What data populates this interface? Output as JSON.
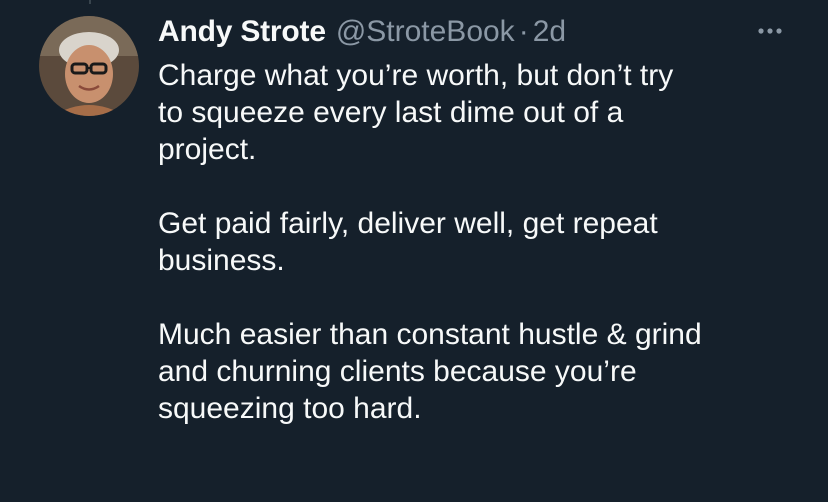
{
  "tweet": {
    "author_name": "Andy Strote",
    "handle": "@StroteBook",
    "separator": "·",
    "time": "2d",
    "more_icon": "more-horizontal-icon",
    "paragraphs": [
      "Charge what you’re worth, but don’t try\nto squeeze every last dime out of a\nproject.",
      "Get paid fairly, deliver well, get repeat\nbusiness.",
      "Much easier than constant hustle & grind\nand churning clients because you’re\nsqueezing too hard."
    ]
  },
  "colors": {
    "background": "#15202b",
    "text_primary": "#f7f9f9",
    "text_secondary": "#8b98a5"
  }
}
